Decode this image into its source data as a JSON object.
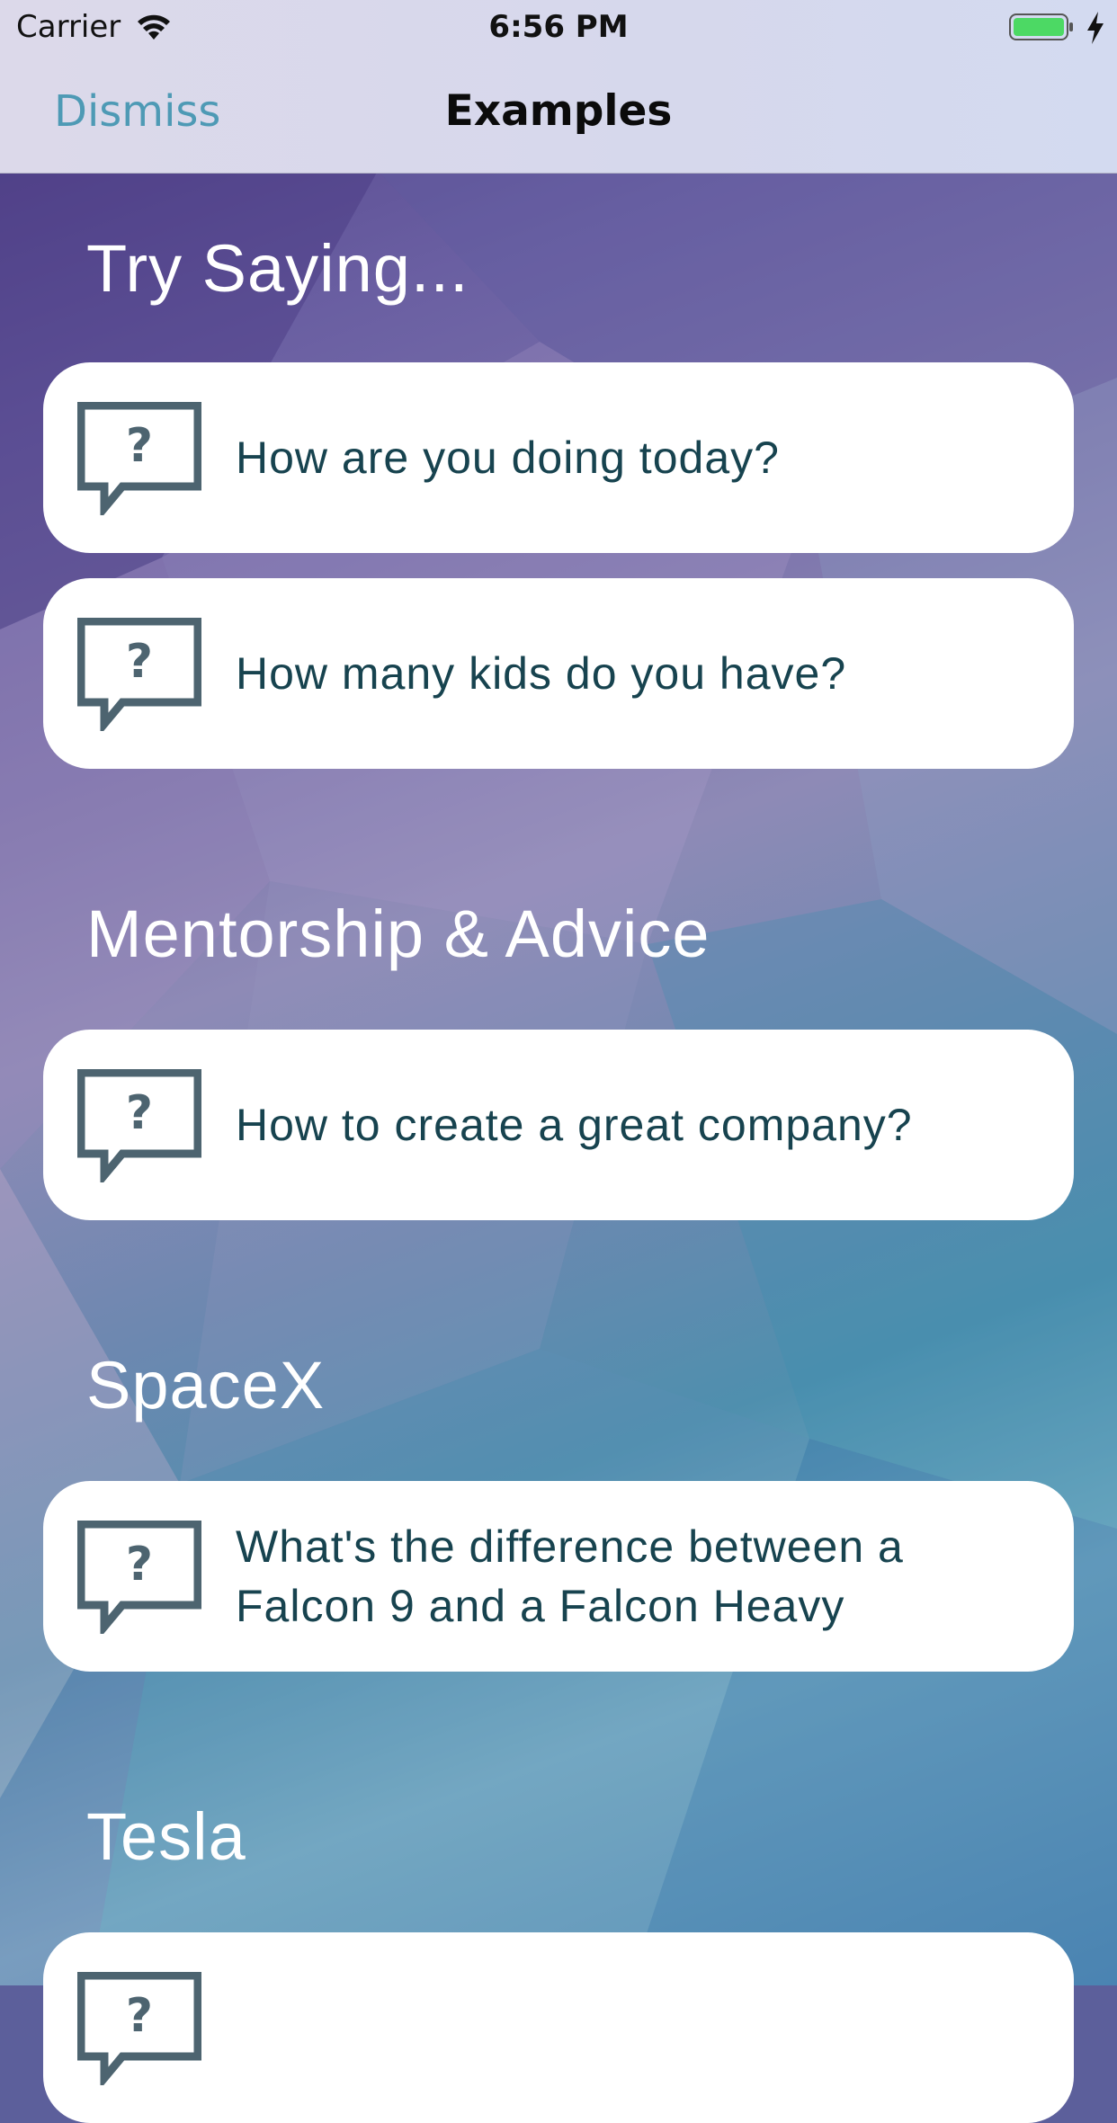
{
  "status_bar": {
    "carrier": "Carrier",
    "time": "6:56 PM"
  },
  "nav": {
    "dismiss_label": "Dismiss",
    "title": "Examples"
  },
  "sections": [
    {
      "title": "Try Saying...",
      "items": [
        "How are you doing today?",
        "How many kids do you have?"
      ]
    },
    {
      "title": "Mentorship & Advice",
      "items": [
        "How to create a great company?"
      ]
    },
    {
      "title": "SpaceX",
      "items": [
        "What's the difference between a Falcon 9 and a Falcon Heavy"
      ]
    },
    {
      "title": "Tesla",
      "items": [
        ""
      ]
    }
  ],
  "colors": {
    "accent": "#4e9ab5",
    "card_text": "#17434f",
    "icon": "#4d6470",
    "battery": "#4cd964"
  },
  "icons": {
    "card": "question-speech-bubble-icon"
  }
}
